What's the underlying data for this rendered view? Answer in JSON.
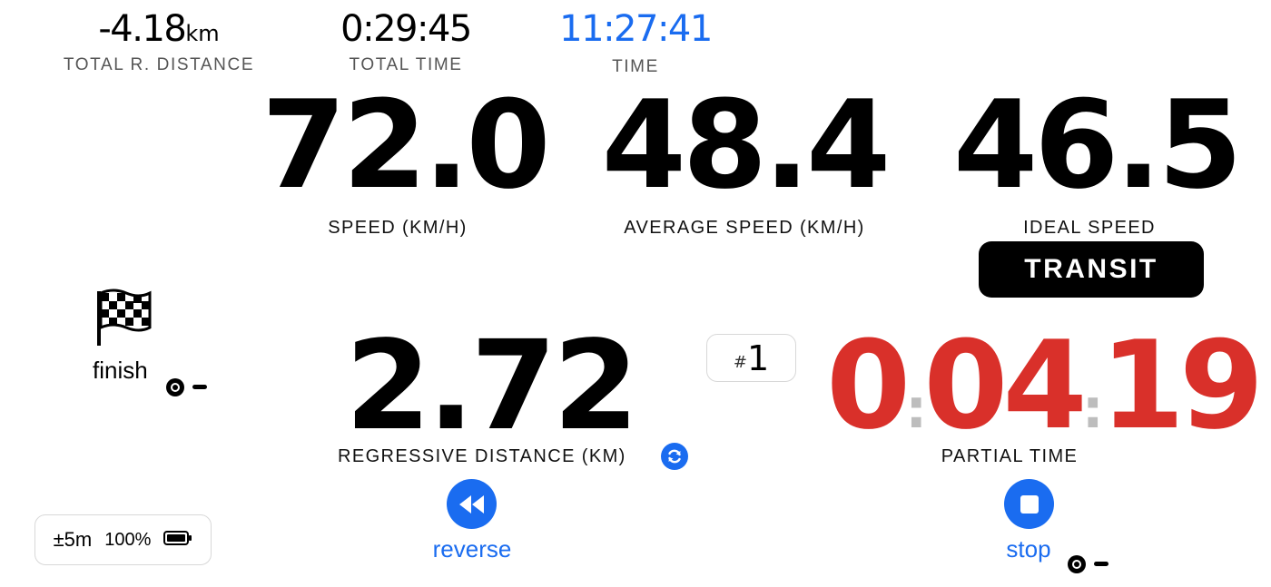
{
  "top": {
    "total_r_distance": {
      "value": "-4.18",
      "unit": "km",
      "label": "TOTAL R. DISTANCE"
    },
    "total_time": {
      "value": "0:29:45",
      "label": "TOTAL TIME"
    },
    "clock": {
      "value": "11:27:41",
      "label": "TIME"
    }
  },
  "speed": {
    "value": "72.0",
    "label": "SPEED (KM/H)"
  },
  "average_speed": {
    "value": "48.4",
    "label": "AVERAGE SPEED (KM/H)"
  },
  "ideal_speed": {
    "value": "46.5",
    "label": "IDEAL SPEED"
  },
  "mode_button": {
    "label": "TRANSIT"
  },
  "finish": {
    "label": "finish",
    "icon": "checkered-flag-icon"
  },
  "regressive_distance": {
    "value": "2.72",
    "label": "REGRESSIVE DISTANCE (KM)"
  },
  "segment": {
    "hash": "#",
    "number": "1"
  },
  "partial_time": {
    "h": "0",
    "mm": "04",
    "ss": "19",
    "sep": ":",
    "label": "PARTIAL TIME"
  },
  "reverse_button": {
    "label": "reverse"
  },
  "stop_button": {
    "label": "stop"
  },
  "status": {
    "accuracy": "±5m",
    "battery": "100%"
  },
  "colors": {
    "accent": "#1a6cf0",
    "partial_time": "#d9302a",
    "separator": "#bdbdbd"
  }
}
